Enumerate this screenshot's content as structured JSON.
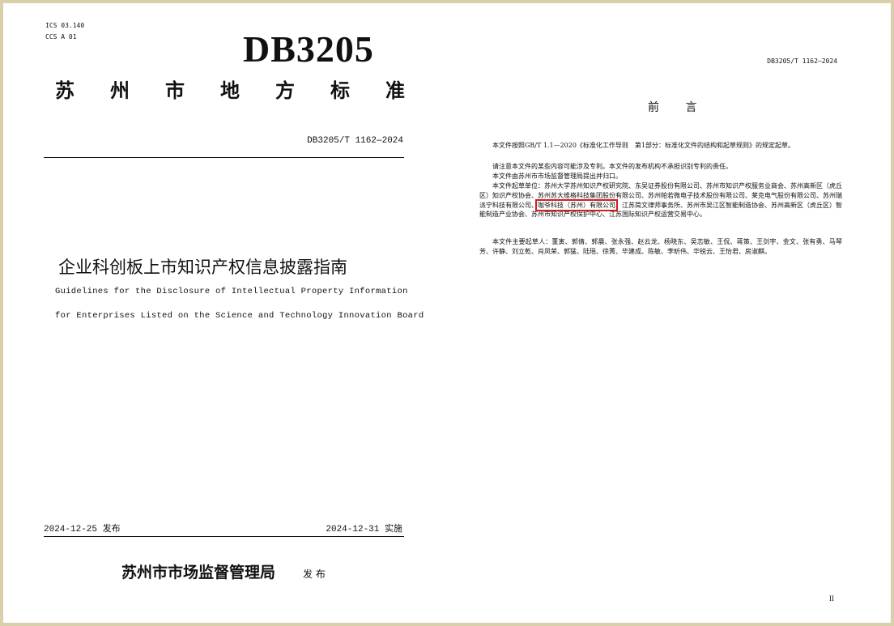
{
  "cover": {
    "ics": "ICS 03.140",
    "ccs": "CCS A 01",
    "code": "DB3205",
    "standard_type_chars": [
      "苏",
      "州",
      "市",
      "地",
      "方",
      "标",
      "准"
    ],
    "doc_number": "DB3205/T 1162—2024",
    "title_cn": "企业科创板上市知识产权信息披露指南",
    "title_en_line1": "Guidelines for the Disclosure of Intellectual Property Information",
    "title_en_line2": "for Enterprises Listed on the Science and Technology Innovation Board",
    "release_date": "2024-12-25 发布",
    "effective_date": "2024-12-31 实施",
    "issuer": "苏州市市场监督管理局",
    "issue_word": "发 布"
  },
  "preface": {
    "header_doc_number": "DB3205/T 1162—2024",
    "title": "前 言",
    "p1": "本文件按照GB/T 1.1—2020《标准化工作导则　第1部分：标准化文件的结构和起草规则》的规定起草。",
    "p2": "请注意本文件的某些内容可能涉及专利。本文件的发布机构不承担识别专利的责任。",
    "p3": "本文件由苏州市市场监督管理局提出并归口。",
    "p4_before": "本文件起草单位：苏州大学苏州知识产权研究院、东吴证券股份有限公司、苏州市知识产权服务业商会、苏州高新区（虎丘区）知识产权协会、苏州苏大维格科技集团股份有限公司、苏州帕若微电子技术股份有限公司、莱克电气股份有限公司、苏州瑞派宁科技有限公司、",
    "p4_highlight": "咖爷科技（苏州）有限公司",
    "p4_after": "、江苏简文律师事务所、苏州市吴江区智能制造协会、苏州高新区（虎丘区）智能制造产业协会、苏州市知识产权保护中心、江苏国际知识产权运营交易中心。",
    "p5": "本文件主要起草人：董寅、郭倩、郭晨、张永强、赵云龙、杨晓东、吴志敏、王侃、蒋策、王剑宇、金文、张有勇、马琴芳、许静、刘立乾、肖凤荣、郭猛、陆瑶、徐菁、毕建成、陈敏、李昕伟、华锐云、王怡君、房淑麒。",
    "page_number": "II"
  }
}
